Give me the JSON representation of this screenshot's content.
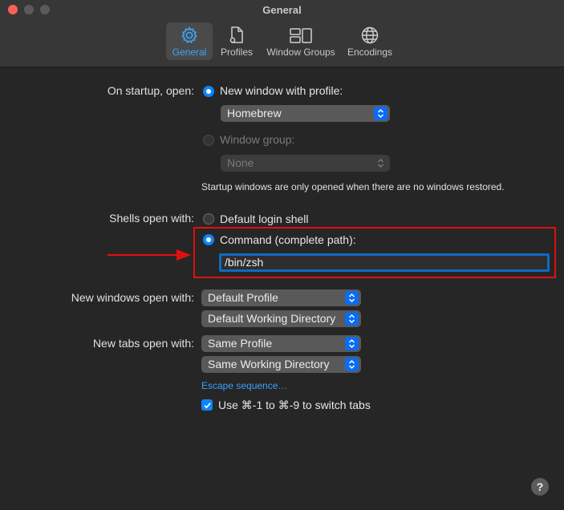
{
  "window": {
    "title": "General"
  },
  "toolbar": {
    "tabs": [
      {
        "label": "General",
        "icon": "gear-icon",
        "active": true
      },
      {
        "label": "Profiles",
        "icon": "profile-document-icon",
        "active": false
      },
      {
        "label": "Window Groups",
        "icon": "window-groups-icon",
        "active": false
      },
      {
        "label": "Encodings",
        "icon": "globe-icon",
        "active": false
      }
    ]
  },
  "startup": {
    "label": "On startup, open:",
    "option_new_window": "New window with profile:",
    "profile_value": "Homebrew",
    "option_window_group": "Window group:",
    "group_value": "None",
    "note": "Startup windows are only opened when there are no windows restored."
  },
  "shells": {
    "label": "Shells open with:",
    "option_default": "Default login shell",
    "option_command": "Command (complete path):",
    "command_value": "/bin/zsh"
  },
  "new_windows": {
    "label": "New windows open with:",
    "profile_value": "Default Profile",
    "directory_value": "Default Working Directory"
  },
  "new_tabs": {
    "label": "New tabs open with:",
    "profile_value": "Same Profile",
    "directory_value": "Same Working Directory"
  },
  "escape_link": "Escape sequence…",
  "switch_tabs_checkbox": {
    "label": "Use ⌘-1 to ⌘-9 to switch tabs",
    "checked": true
  },
  "help_button": "?",
  "colors": {
    "accent": "#0a84ff",
    "active_tab_text": "#38a8ff",
    "annotation_red": "#e01010"
  }
}
